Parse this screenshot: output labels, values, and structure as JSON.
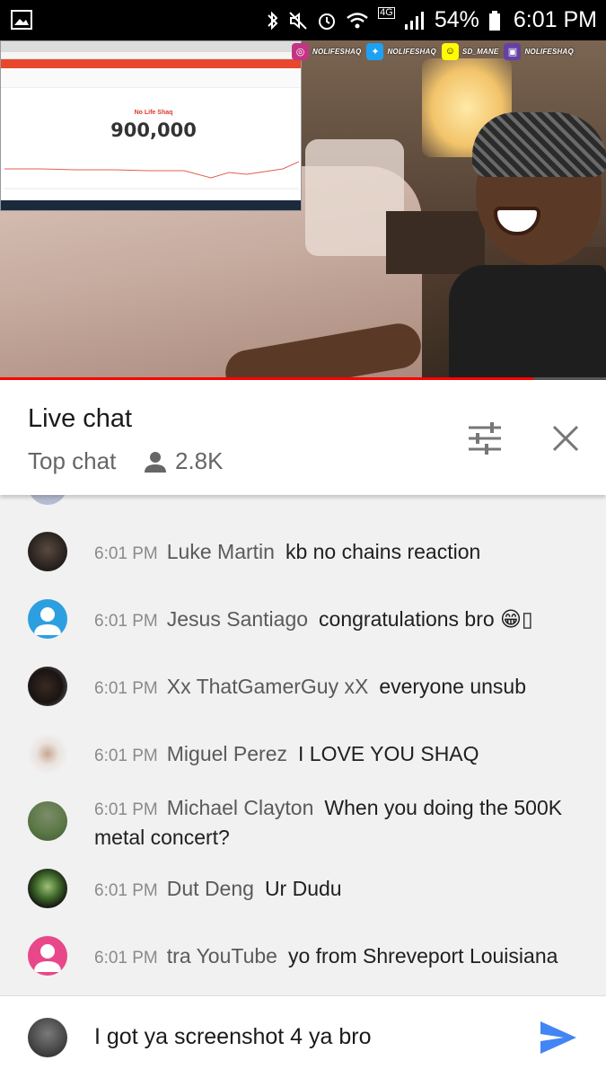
{
  "status_bar": {
    "battery": "54%",
    "time": "6:01 PM",
    "network": "4G",
    "icons": [
      "gallery-icon",
      "bluetooth-icon",
      "mute-icon",
      "alarm-icon",
      "wifi-icon",
      "signal-icon",
      "battery-icon"
    ]
  },
  "video": {
    "progress": 0.88,
    "progress_color": "#ff0000",
    "socials": [
      {
        "icon": "instagram-icon",
        "label": "NOLIFESHAQ",
        "color": "#c13584"
      },
      {
        "icon": "twitter-icon",
        "label": "NOLIFESHAQ",
        "color": "#1da1f2"
      },
      {
        "icon": "snapchat-icon",
        "label": "SD_MANE",
        "color": "#fffc00"
      },
      {
        "icon": "twitch-icon",
        "label": "NOLIFESHAQ",
        "color": "#6441a5"
      }
    ],
    "inset": {
      "channel_name": "No Life Shaq",
      "subscriber_count": "900,000"
    }
  },
  "chat": {
    "title": "Live chat",
    "mode": "Top chat",
    "viewers": "2.8K",
    "messages": [
      {
        "time": "6:01 PM",
        "author": "Luke Martin",
        "text": "kb no chains reaction",
        "avatar": "photo-avatar-dark"
      },
      {
        "time": "6:01 PM",
        "author": "Jesus Santiago",
        "text": "congratulations bro 😁▯",
        "avatar": "default-avatar-blue"
      },
      {
        "time": "6:01 PM",
        "author": "Xx ThatGamerGuy xX",
        "text": "everyone unsub",
        "avatar": "photo-avatar-dog"
      },
      {
        "time": "6:01 PM",
        "author": "Miguel Perez",
        "text": "I LOVE YOU SHAQ",
        "avatar": "photo-avatar-cartoon"
      },
      {
        "time": "6:01 PM",
        "author": "Michael Clayton",
        "text": "When you doing the 500K metal concert?",
        "avatar": "photo-avatar-outdoor"
      },
      {
        "time": "6:01 PM",
        "author": "Dut Deng",
        "text": "Ur Dudu",
        "avatar": "photo-avatar-green"
      },
      {
        "time": "6:01 PM",
        "author": "tra YouTube",
        "text": "yo from Shreveport Louisiana",
        "avatar": "default-avatar-pink"
      }
    ]
  },
  "input": {
    "value": "I got ya screenshot 4 ya bro"
  },
  "colors": {
    "accent": "#4285f4",
    "chat_bg": "#f1f1f1",
    "youtube_red": "#ff0000"
  }
}
